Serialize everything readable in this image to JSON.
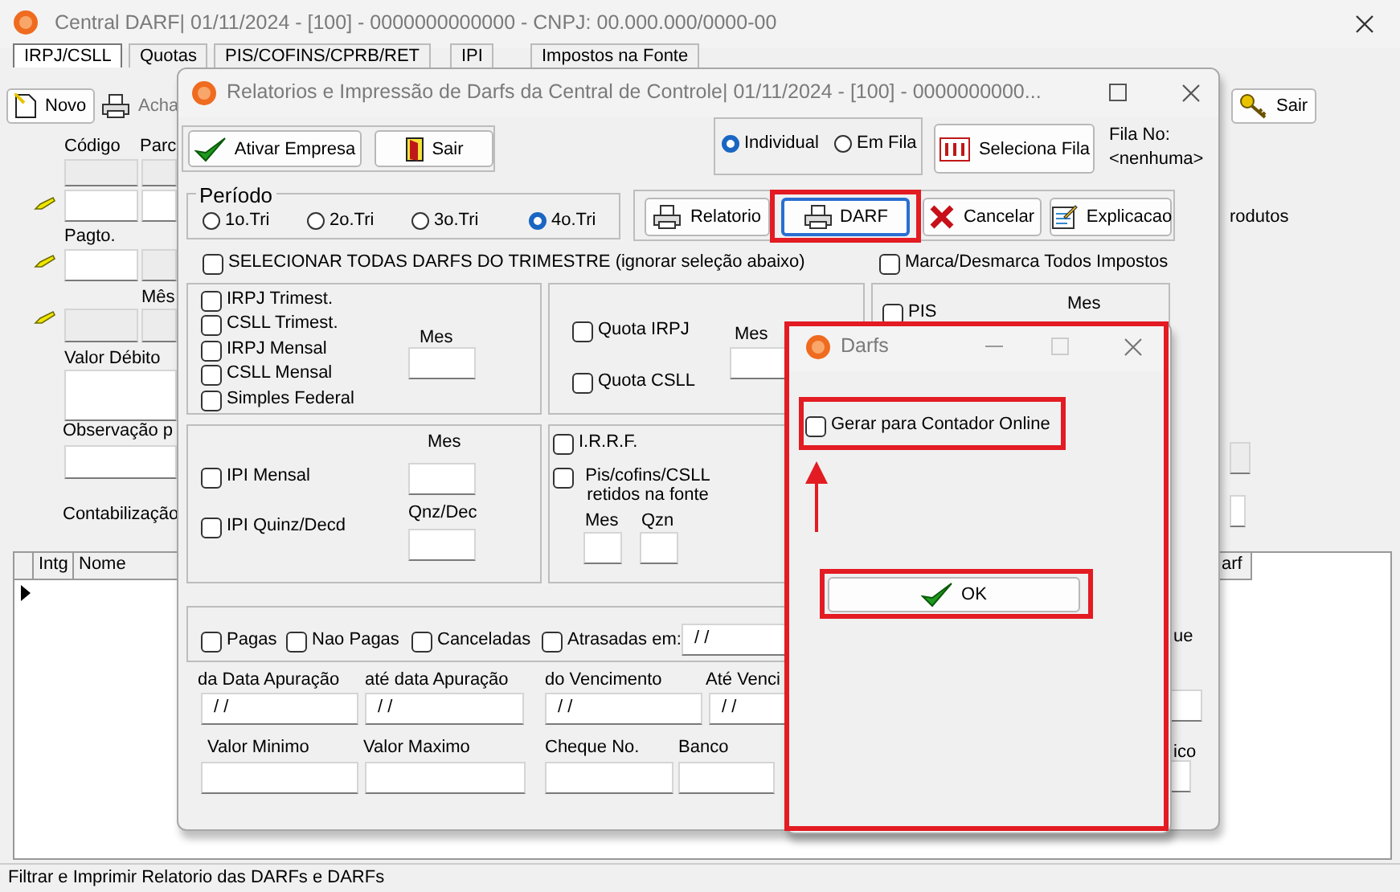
{
  "main_window": {
    "title": "Central DARF|  01/11/2024 - [100] - 0000000000000 - CNPJ: 00.000.000/0000-00",
    "tabs": [
      {
        "label": "IRPJ/CSLL",
        "selected": true
      },
      {
        "label": "Quotas",
        "selected": false
      },
      {
        "label": "PIS/COFINS/CPRB/RET",
        "selected": false
      },
      {
        "label": "IPI",
        "selected": false
      },
      {
        "label": "Impostos na Fonte",
        "selected": false
      }
    ],
    "toolbar": [
      {
        "label": "Novo",
        "disabled": false
      },
      {
        "label": "Acha",
        "disabled": true
      },
      {
        "label": "Sair",
        "disabled": false
      }
    ],
    "labels": [
      "Código",
      "Parc",
      "Pagto.",
      "Mês",
      "Valor Débito",
      "Observação p",
      "Contabilização",
      "rodutos"
    ],
    "grid": {
      "columns": [
        "Intg",
        "Nome",
        "arf"
      ]
    },
    "status_bar": "Filtrar e Imprimir Relatorio das DARFs e DARFs"
  },
  "report_dialog": {
    "title": "Relatorios e Impressão de Darfs da Central de Controle|  01/11/2024 - [100] - 0000000000...",
    "buttons": [
      "Ativar Empresa",
      "Sair"
    ],
    "mode_options": [
      {
        "label": "Individual",
        "selected": true
      },
      {
        "label": "Em Fila",
        "selected": false
      }
    ],
    "queue_button": "Seleciona Fila",
    "queue_label": "Fila No:",
    "queue_value": "<nenhuma>",
    "period": {
      "label": "Período",
      "options": [
        {
          "label": "1o.Tri",
          "selected": false
        },
        {
          "label": "2o.Tri",
          "selected": false
        },
        {
          "label": "3o.Tri",
          "selected": false
        },
        {
          "label": "4o.Tri",
          "selected": true
        }
      ]
    },
    "actions": [
      {
        "label": "Relatorio",
        "highlighted": false
      },
      {
        "label": "DARF",
        "highlighted": true
      },
      {
        "label": "Cancelar",
        "highlighted": false
      },
      {
        "label": "Explicacao",
        "highlighted": false
      }
    ],
    "select_all": {
      "label": "SELECIONAR TODAS DARFS DO TRIMESTRE (ignorar seleção abaixo)",
      "checked": false
    },
    "toggle_all": {
      "label": "Marca/Desmarca Todos Impostos",
      "checked": false
    },
    "taxes": [
      {
        "label": "IRPJ Trimest.",
        "checked": false
      },
      {
        "label": "CSLL Trimest.",
        "checked": false
      },
      {
        "label": "IRPJ Mensal",
        "checked": false
      },
      {
        "label": "CSLL Mensal",
        "checked": false
      },
      {
        "label": "Simples Federal",
        "checked": false
      },
      {
        "label": "Quota IRPJ",
        "checked": false
      },
      {
        "label": "Quota CSLL",
        "checked": false
      },
      {
        "label": "PIS",
        "checked": false
      },
      {
        "label": "IPI Mensal",
        "checked": false
      },
      {
        "label": "IPI Quinz/Decd",
        "checked": false
      },
      {
        "label": "I.R.R.F.",
        "checked": false
      },
      {
        "label": "Pis/cofins/CSLL retidos na fonte",
        "checked": false
      }
    ],
    "field_labels": [
      "Mes",
      "Mes",
      "Mes",
      "Mes",
      "Qnz/Dec",
      "Mes",
      "Qzn"
    ],
    "status_filters": [
      {
        "label": "Pagas",
        "checked": false
      },
      {
        "label": "Nao Pagas",
        "checked": false
      },
      {
        "label": "Canceladas",
        "checked": false
      },
      {
        "label": "Atrasadas em:",
        "checked": false
      }
    ],
    "overdue_date": " / /",
    "date_filters": [
      {
        "label": "da Data Apuração",
        "value": " / /"
      },
      {
        "label": "até data Apuração",
        "value": " / /"
      },
      {
        "label": "do Vencimento",
        "value": " / /"
      },
      {
        "label": "Até Venci",
        "value": " / /"
      }
    ],
    "value_filters": [
      "Valor Minimo",
      "Valor Maximo",
      "Cheque No.",
      "Banco"
    ],
    "partial_labels": [
      "ue",
      "ico"
    ]
  },
  "darfs_dialog": {
    "title": "Darfs",
    "highlighted": true,
    "option": {
      "label": "Gerar para Contador Online",
      "checked": false,
      "highlighted": true
    },
    "ok_button": {
      "label": "OK",
      "highlighted": true
    }
  }
}
